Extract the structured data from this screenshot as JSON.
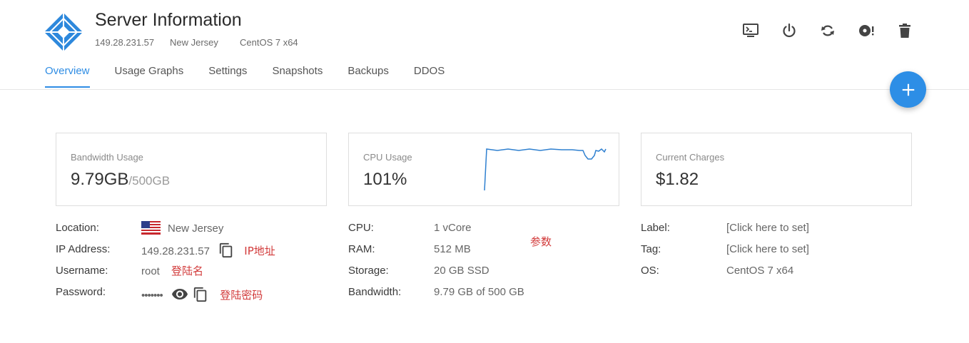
{
  "header": {
    "title": "Server Information",
    "ip": "149.28.231.57",
    "location": "New Jersey",
    "os": "CentOS 7 x64"
  },
  "actions": [
    {
      "icon": "console-icon"
    },
    {
      "icon": "power-icon"
    },
    {
      "icon": "restart-icon"
    },
    {
      "icon": "reinstall-icon"
    },
    {
      "icon": "trash-icon"
    }
  ],
  "tabs": [
    "Overview",
    "Usage Graphs",
    "Settings",
    "Snapshots",
    "Backups",
    "DDOS"
  ],
  "active_tab": "Overview",
  "fab": {
    "icon": "plus-icon"
  },
  "cards": {
    "bandwidth": {
      "label": "Bandwidth Usage",
      "used": "9.79GB",
      "total": "/500GB"
    },
    "cpu": {
      "label": "CPU Usage",
      "value": "101%"
    },
    "charges": {
      "label": "Current Charges",
      "value": "$1.82"
    }
  },
  "details": {
    "location_label": "Location:",
    "location_value": "New Jersey",
    "ip_label": "IP Address:",
    "ip_value": "149.28.231.57",
    "username_label": "Username:",
    "username_value": "root",
    "password_label": "Password:",
    "password_value": "•••••••",
    "cpu_label": "CPU:",
    "cpu_value": "1 vCore",
    "ram_label": "RAM:",
    "ram_value": "512 MB",
    "storage_label": "Storage:",
    "storage_value": "20 GB SSD",
    "bandwidth_label": "Bandwidth:",
    "bandwidth_value": "9.79 GB of 500 GB",
    "label_label": "Label:",
    "label_value": "[Click here to set]",
    "tag_label": "Tag:",
    "tag_value": "[Click here to set]",
    "os_label": "OS:",
    "os_value": "CentOS 7 x64"
  },
  "annotations": {
    "ip": "IP地址",
    "username": "登陆名",
    "password": "登陆密码",
    "params": "参数"
  },
  "colors": {
    "accent": "#2f8de4",
    "annotation": "#d23a3a"
  }
}
